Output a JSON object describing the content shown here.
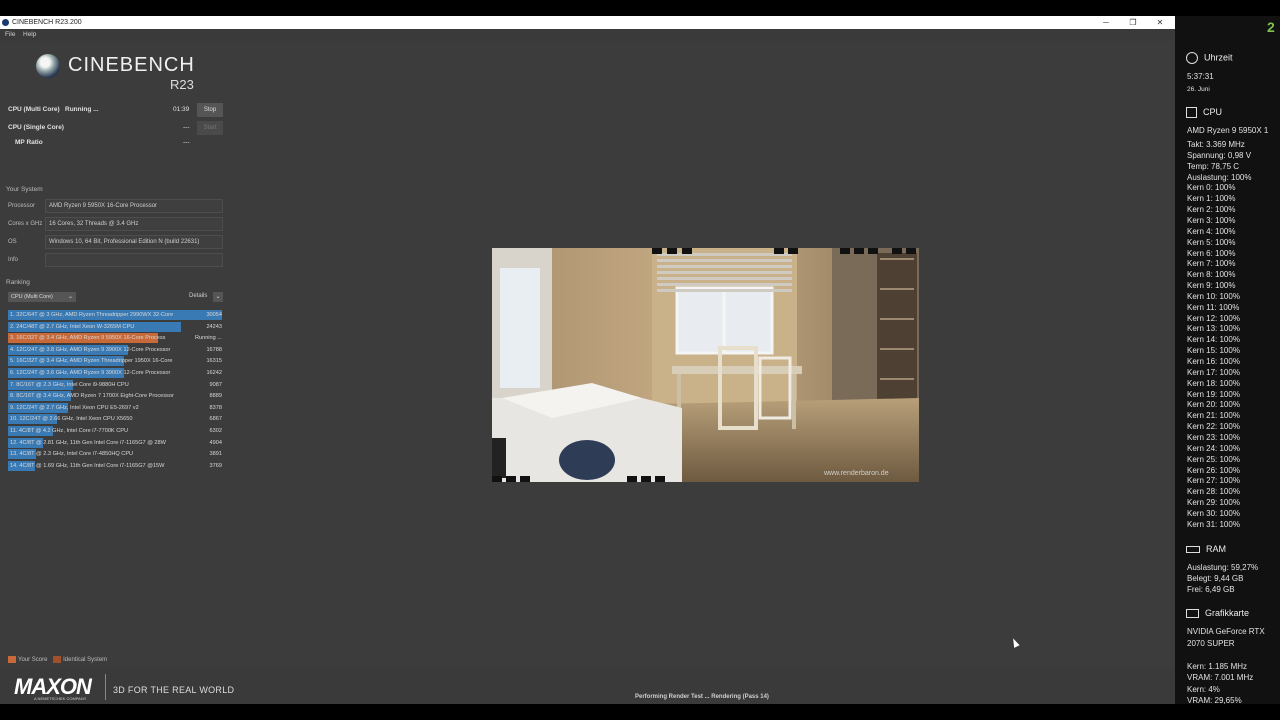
{
  "window": {
    "title": "CINEBENCH R23.200",
    "minimize": "─",
    "maximize": "❐",
    "close": "✕"
  },
  "menu": [
    "File",
    "Help"
  ],
  "logo": {
    "name": "CINEBENCH",
    "version": "R23"
  },
  "tests": [
    {
      "label": "CPU (Multi Core)",
      "status": "Running ...",
      "time": "01:39",
      "button": "Stop"
    },
    {
      "label": "CPU (Single Core)",
      "status": "",
      "time": "---",
      "button": "Start"
    },
    {
      "label": "MP Ratio",
      "status": "",
      "time": "---",
      "button": ""
    }
  ],
  "system": {
    "title": "Your System",
    "rows": [
      {
        "key": "Processor",
        "value": "AMD Ryzen 9 5950X 16-Core Processor"
      },
      {
        "key": "Cores x GHz",
        "value": "16 Cores, 32 Threads @ 3.4 GHz"
      },
      {
        "key": "OS",
        "value": "Windows 10, 64 Bit, Professional Edition N (build 22631)"
      },
      {
        "key": "Info",
        "value": ""
      }
    ]
  },
  "ranking": {
    "title": "Ranking",
    "dropdown": "CPU (Multi Core)",
    "details": "Details",
    "max_score": 30054,
    "items": [
      {
        "text": "1. 32C/64T @ 3 GHz, AMD Ryzen Threadripper 2990WX 32-Core",
        "score": "30054",
        "value": 30054,
        "mine": false
      },
      {
        "text": "2. 24C/48T @ 2.7 GHz, Intel Xeon W-3265M CPU",
        "score": "24243",
        "value": 24243,
        "mine": false
      },
      {
        "text": "3. 16C/32T @ 3.4 GHz, AMD Ryzen 9 5950X 16-Core Process",
        "score": "Running ...",
        "value": 21000,
        "mine": true
      },
      {
        "text": "4. 12C/24T @ 3.8 GHz, AMD Ryzen 9 3900X 12-Core Processor",
        "score": "16788",
        "value": 16788,
        "mine": false
      },
      {
        "text": "5. 16C/32T @ 3.4 GHz, AMD Ryzen Threadripper 1950X 16-Core",
        "score": "16315",
        "value": 16315,
        "mine": false
      },
      {
        "text": "6. 12C/24T @ 3.6 GHz, AMD Ryzen 9 3900X 12-Core Processor",
        "score": "16242",
        "value": 16242,
        "mine": false
      },
      {
        "text": "7. 8C/16T @ 2.3 GHz, Intel Core i9-9880H CPU",
        "score": "9087",
        "value": 9087,
        "mine": false
      },
      {
        "text": "8. 8C/16T @ 3.4 GHz, AMD Ryzen 7 1700X Eight-Core Processor",
        "score": "8889",
        "value": 8889,
        "mine": false
      },
      {
        "text": "9. 12C/24T @ 2.7 GHz, Intel Xeon CPU E5-2697 v2",
        "score": "8378",
        "value": 8378,
        "mine": false
      },
      {
        "text": "10. 12C/24T @ 2.66 GHz, Intel Xeon CPU X5650",
        "score": "6867",
        "value": 6867,
        "mine": false
      },
      {
        "text": "11. 4C/8T @ 4.2 GHz, Intel Core i7-7700K CPU",
        "score": "6302",
        "value": 6302,
        "mine": false
      },
      {
        "text": "12. 4C/8T @ 2.81 GHz, 11th Gen Intel Core i7-1165G7 @ 28W",
        "score": "4904",
        "value": 4904,
        "mine": false
      },
      {
        "text": "13. 4C/8T @ 2.3 GHz, Intel Core i7-4850HQ CPU",
        "score": "3891",
        "value": 3891,
        "mine": false
      },
      {
        "text": "14. 4C/8T @ 1.69 GHz, 11th Gen Intel Core i7-1165G7 @15W",
        "score": "3769",
        "value": 3769,
        "mine": false
      }
    ],
    "legend": {
      "your_score": "Your Score",
      "identical": "Identical System"
    }
  },
  "footer": {
    "brand": "MAXON",
    "brand_sub": "A NEMETSCHEK COMPANY",
    "tagline": "3D FOR THE REAL WORLD",
    "status": "Performing Render Test ... Rendering (Pass 14)"
  },
  "render": {
    "watermark": "www.renderbaron.de"
  },
  "colors": {
    "accent": "#3a7ab4",
    "mine": "#c8693a",
    "monitor_number": "#7ec34a"
  },
  "monitor": {
    "number": "2",
    "time": {
      "title": "Uhrzeit",
      "icon": "clock-icon",
      "time": "5:37:31",
      "date": "26. Juni"
    },
    "cpu": {
      "title": "CPU",
      "icon": "cpu-icon",
      "name": "AMD Ryzen 9 5950X 1",
      "lines": [
        "Takt: 3.369 MHz",
        "Spannung: 0,98 V",
        "Temp: 78,75 C",
        "Auslastung: 100%",
        "Kern 0: 100%",
        "Kern 1: 100%",
        "Kern 2: 100%",
        "Kern 3: 100%",
        "Kern 4: 100%",
        "Kern 5: 100%",
        "Kern 6: 100%",
        "Kern 7: 100%",
        "Kern 8: 100%",
        "Kern 9: 100%",
        "Kern 10: 100%",
        "Kern 11: 100%",
        "Kern 12: 100%",
        "Kern 13: 100%",
        "Kern 14: 100%",
        "Kern 15: 100%",
        "Kern 16: 100%",
        "Kern 17: 100%",
        "Kern 18: 100%",
        "Kern 19: 100%",
        "Kern 20: 100%",
        "Kern 21: 100%",
        "Kern 22: 100%",
        "Kern 23: 100%",
        "Kern 24: 100%",
        "Kern 25: 100%",
        "Kern 26: 100%",
        "Kern 27: 100%",
        "Kern 28: 100%",
        "Kern 29: 100%",
        "Kern 30: 100%",
        "Kern 31: 100%"
      ]
    },
    "ram": {
      "title": "RAM",
      "icon": "ram-icon",
      "lines": [
        "Auslastung: 59,27%",
        "Belegt: 9,44 GB",
        "Frei: 6,49 GB"
      ]
    },
    "gpu": {
      "title": "Grafikkarte",
      "icon": "monitor-icon",
      "lines": [
        "NVIDIA GeForce RTX",
        "2070 SUPER",
        "",
        "Kern: 1.185 MHz",
        "VRAM: 7.001 MHz",
        "Kern: 4%",
        "VRAM: 29,65%"
      ]
    }
  }
}
